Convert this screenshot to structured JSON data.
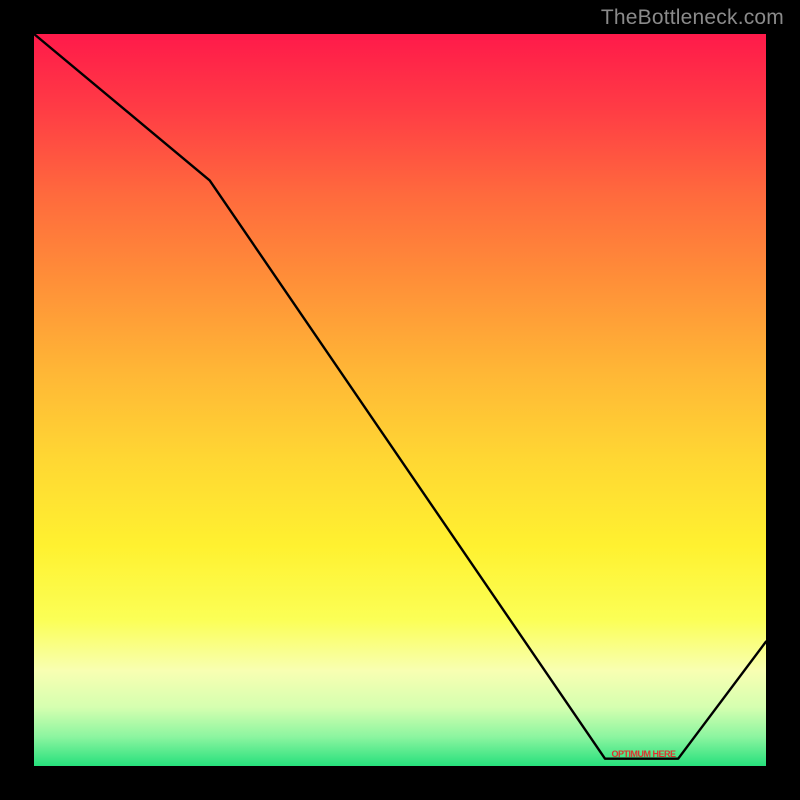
{
  "watermark": "TheBottleneck.com",
  "min_label": "OPTIMUM HERE",
  "chart_data": {
    "type": "line",
    "title": "",
    "xlabel": "",
    "ylabel": "",
    "xlim": [
      0,
      100
    ],
    "ylim": [
      0,
      100
    ],
    "series": [
      {
        "name": "bottleneck-curve",
        "x": [
          0,
          24,
          78,
          88,
          100
        ],
        "values": [
          100,
          80,
          1,
          1,
          17
        ]
      }
    ],
    "min_region": {
      "x_start": 78,
      "x_end": 88,
      "y": 1
    },
    "gradient_stops": [
      {
        "pos": 0.0,
        "color": "#ff1a4a"
      },
      {
        "pos": 0.1,
        "color": "#ff3b45"
      },
      {
        "pos": 0.22,
        "color": "#ff6a3d"
      },
      {
        "pos": 0.34,
        "color": "#ff9038"
      },
      {
        "pos": 0.46,
        "color": "#ffb636"
      },
      {
        "pos": 0.58,
        "color": "#ffd733"
      },
      {
        "pos": 0.7,
        "color": "#fff130"
      },
      {
        "pos": 0.8,
        "color": "#fbff56"
      },
      {
        "pos": 0.87,
        "color": "#f8ffb2"
      },
      {
        "pos": 0.92,
        "color": "#d5ffb0"
      },
      {
        "pos": 0.96,
        "color": "#8cf5a0"
      },
      {
        "pos": 1.0,
        "color": "#26e07c"
      }
    ]
  }
}
